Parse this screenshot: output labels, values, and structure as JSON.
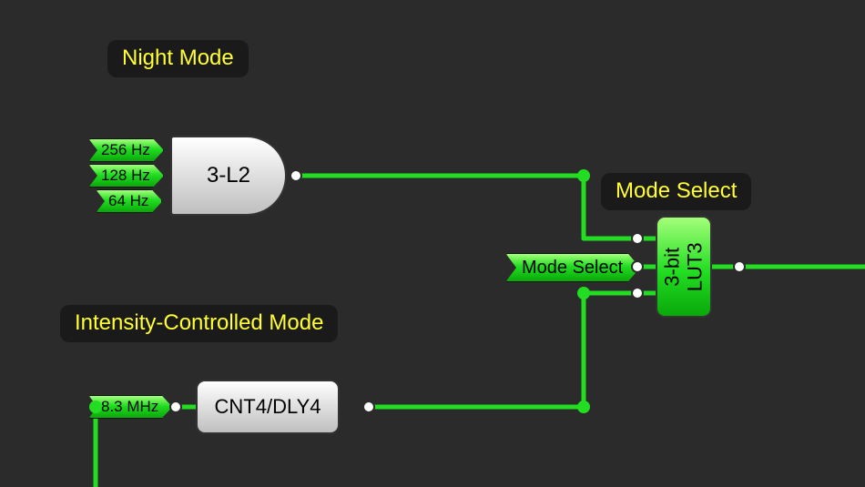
{
  "labels": {
    "night_mode": "Night Mode",
    "intensity_mode": "Intensity-Controlled Mode",
    "mode_select_title": "Mode Select"
  },
  "inputs": {
    "and_in_0": "256 Hz",
    "and_in_1": "128 Hz",
    "and_in_2": "64 Hz",
    "cnt_in": "8.3 MHz",
    "lut_mid_tag": "Mode Select"
  },
  "blocks": {
    "and_gate": "3-L2",
    "cnt_block": "CNT4/DLY4",
    "lut_line1": "3-bit",
    "lut_line2": "LUT3"
  }
}
